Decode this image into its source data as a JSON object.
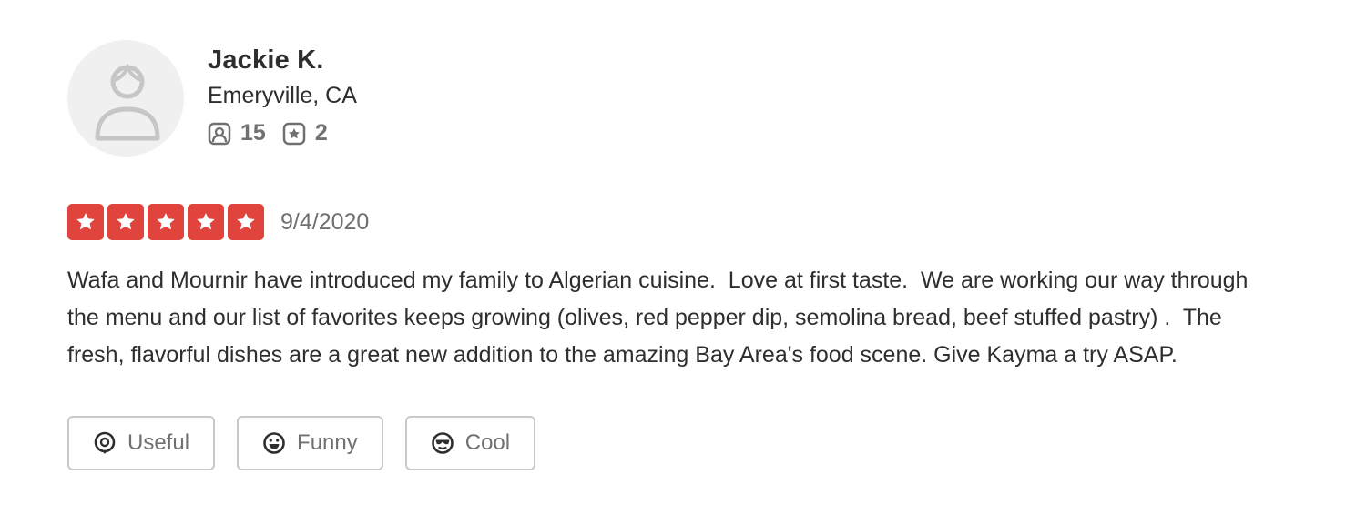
{
  "user": {
    "name": "Jackie K.",
    "location": "Emeryville, CA",
    "stats": [
      {
        "icon": "friends-icon",
        "value": "15"
      },
      {
        "icon": "review-star-icon",
        "value": "2"
      }
    ]
  },
  "review": {
    "rating": 5,
    "rating_max": 5,
    "star_color": "#e0443d",
    "date": "9/4/2020",
    "text": "Wafa and Mournir have introduced my family to Algerian cuisine.  Love at first taste.  We are working our way through the menu and our list of favorites keeps growing (olives, red pepper dip, semolina bread, beef stuffed pastry) .  The fresh, flavorful dishes are a great new addition to the amazing Bay Area's food scene. Give Kayma a try ASAP."
  },
  "reactions": {
    "useful_label": "Useful",
    "funny_label": "Funny",
    "cool_label": "Cool"
  }
}
